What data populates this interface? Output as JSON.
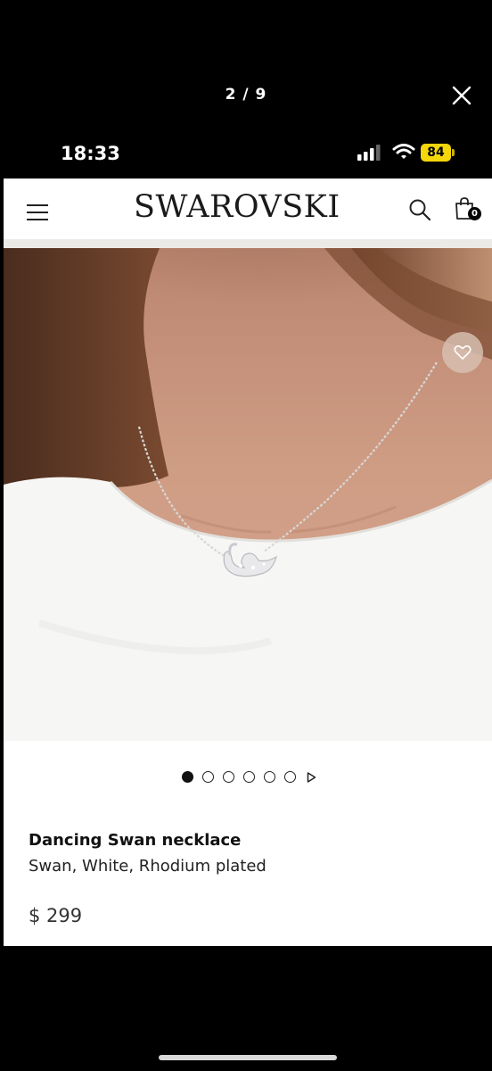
{
  "viewer": {
    "counter": "2 / 9"
  },
  "status_bar": {
    "time": "18:33",
    "battery": "84"
  },
  "header": {
    "logo": "SWAROVSKI",
    "bag_count": "0"
  },
  "gallery": {
    "total_dots": 6,
    "active_index": 0
  },
  "product": {
    "name": "Dancing Swan necklace",
    "description": "Swan, White, Rhodium plated",
    "price": "$ 299"
  },
  "colors": {
    "battery": "#f5d60a",
    "page_background": "#ffffff",
    "viewer_background": "#000000"
  }
}
